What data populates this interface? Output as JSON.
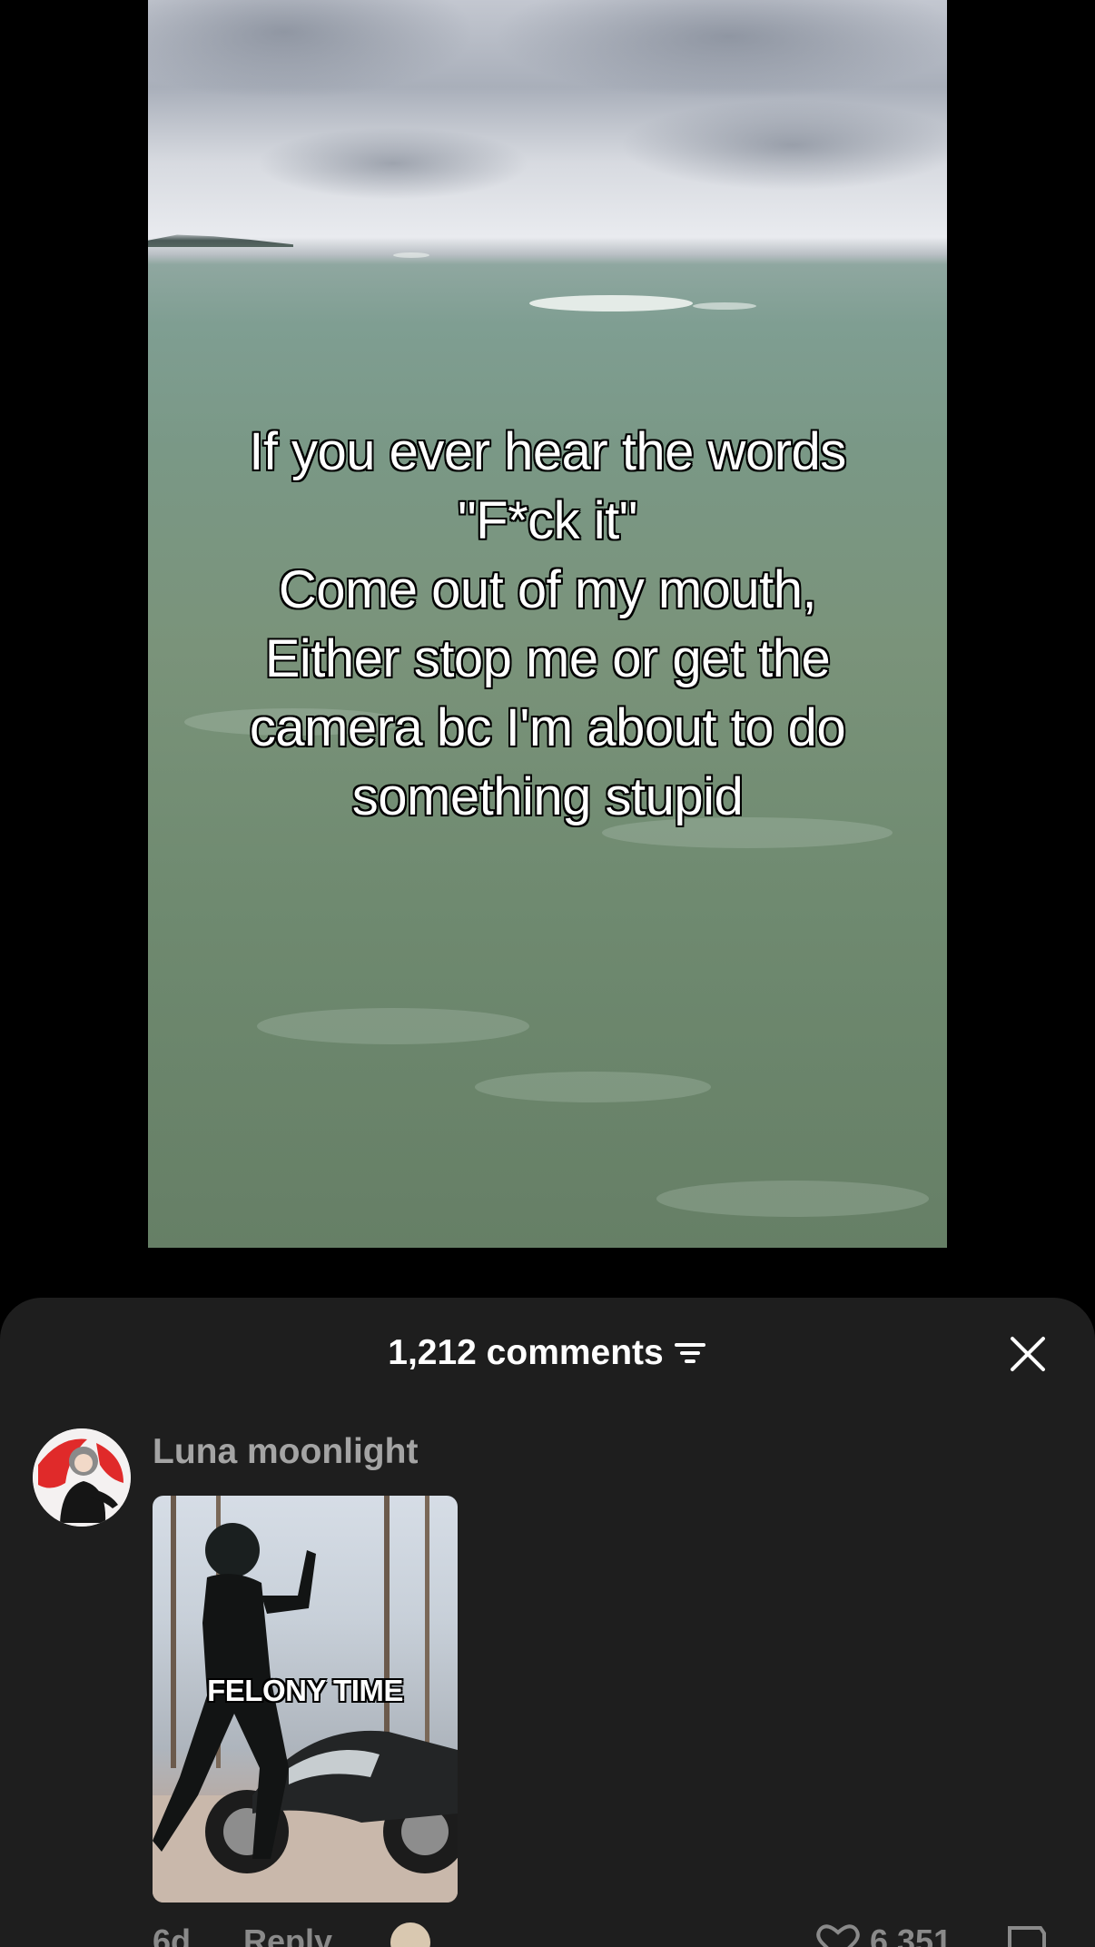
{
  "video": {
    "caption_lines": [
      "If you ever hear the words",
      "\"F*ck it\"",
      "Come out of my mouth,",
      "Either stop me or get the",
      "camera bc I'm about to do",
      "something stupid"
    ]
  },
  "comments_sheet": {
    "count_label": "1,212 comments",
    "filter_icon": "filter-icon",
    "close_icon": "close-icon",
    "comment": {
      "author": "Luna moonlight",
      "gif_caption": "FELONY TIME",
      "time": "6d",
      "reply_label": "Reply",
      "like_count": "6,351"
    }
  },
  "colors": {
    "sheet_background": "#1e1e1e",
    "author_text": "#a4a4a4",
    "meta_text": "#8a8a8a"
  }
}
